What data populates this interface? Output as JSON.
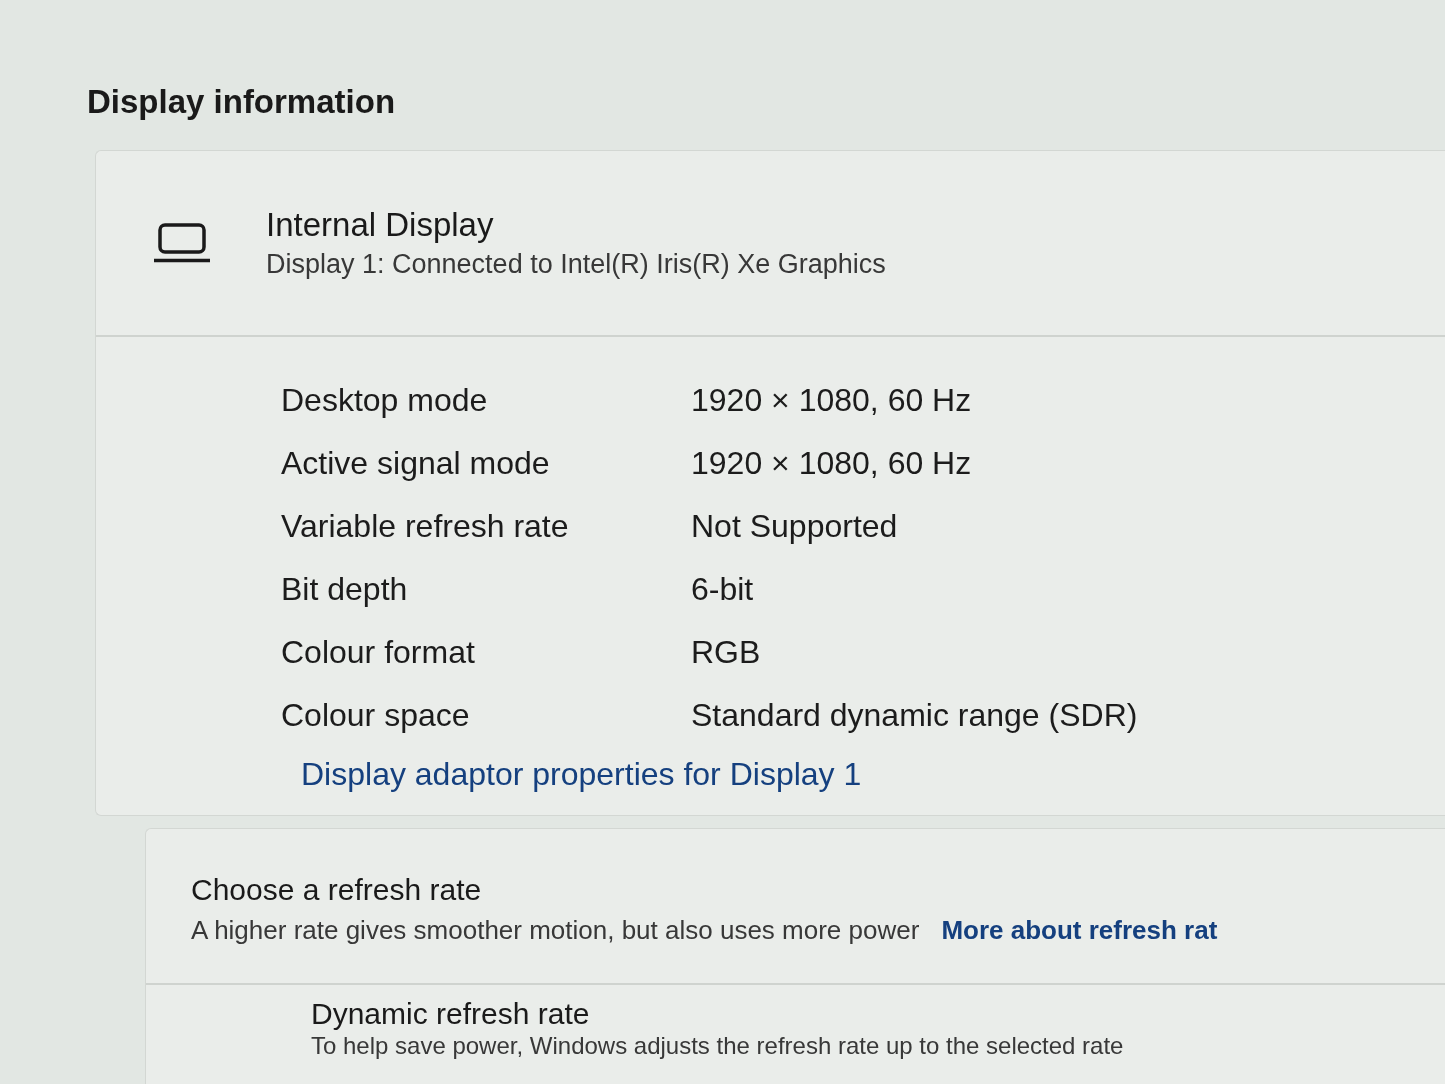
{
  "section_title": "Display information",
  "display_card": {
    "title": "Internal Display",
    "subtitle": "Display 1: Connected to Intel(R) Iris(R) Xe Graphics",
    "properties": [
      {
        "label": "Desktop mode",
        "value": "1920 × 1080, 60 Hz"
      },
      {
        "label": "Active signal mode",
        "value": "1920 × 1080, 60 Hz"
      },
      {
        "label": "Variable refresh rate",
        "value": "Not Supported"
      },
      {
        "label": "Bit depth",
        "value": "6-bit"
      },
      {
        "label": "Colour format",
        "value": "RGB"
      },
      {
        "label": "Colour space",
        "value": "Standard dynamic range (SDR)"
      }
    ],
    "link": "Display adaptor properties for Display 1"
  },
  "refresh_card": {
    "title": "Choose a refresh rate",
    "description": "A higher rate gives smoother motion, but also uses more power",
    "link": "More about refresh rat",
    "dynamic_refresh": {
      "title": "Dynamic refresh rate",
      "description": "To help save power, Windows adjusts the refresh rate up to the selected rate"
    }
  }
}
